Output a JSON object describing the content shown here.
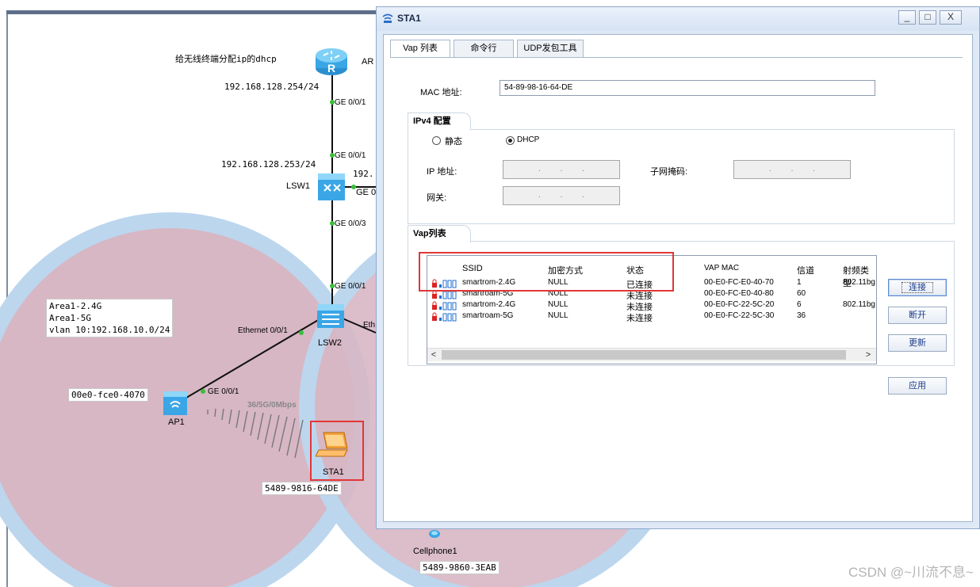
{
  "topology": {
    "router_note": "给无线终端分配ip的dhcp",
    "router_name": "AR",
    "router_ip": "192.168.128.254/24",
    "port_ar_ge001": "GE 0/0/1",
    "port_lsw1_ge001": "GE 0/0/1",
    "lsw1_ip": "192.168.128.253/24",
    "lsw1_ip_partial": "192.",
    "lsw1_name": "LSW1",
    "port_lsw1_right": "GE 0",
    "port_lsw1_ge003": "GE 0/0/3",
    "port_lsw2_ge001": "GE 0/0/1",
    "lsw2_name": "LSW2",
    "port_lsw2_eth001": "Ethernet 0/0/1",
    "port_lsw2_right": "Eth",
    "area_note_lines": [
      "Area1-2.4G",
      "Area1-5G",
      "vlan 10:192.168.10.0/24"
    ],
    "ap1_mac": "00e0-fce0-4070",
    "ap1_port": "GE 0/0/1",
    "ap1_name": "AP1",
    "wireless_link": "36/5G/0Mbps",
    "sta1_name": "STA1",
    "sta1_mac": "5489-9816-64DE",
    "cellphone_name": "Cellphone1",
    "cellphone_mac": "5489-9860-3EAB"
  },
  "window": {
    "title": "STA1",
    "buttons": {
      "minimize": "_",
      "maximize": "□",
      "close": "X"
    },
    "tabs": [
      {
        "label": "Vap 列表",
        "active": true
      },
      {
        "label": "命令行",
        "active": false
      },
      {
        "label": "UDP发包工具",
        "active": false
      }
    ],
    "mac_label": "MAC 地址:",
    "mac_value": "54-89-98-16-64-DE",
    "ipv4": {
      "group_title": "IPv4 配置",
      "static_label": "静态",
      "dhcp_label": "DHCP",
      "selected": "DHCP",
      "ip_label": "IP 地址:",
      "mask_label": "子网掩码:",
      "gateway_label": "网关:",
      "ip_value": ". . .",
      "mask_value": ". . .",
      "gateway_value": ". . ."
    },
    "vap": {
      "group_title": "Vap列表",
      "columns": [
        "SSID",
        "加密方式",
        "状态",
        "VAP MAC",
        "信道",
        "射频类型"
      ],
      "rows": [
        {
          "ssid": "smartrom-2.4G",
          "enc": "NULL",
          "status": "已连接",
          "mac": "00-E0-FC-E0-40-70",
          "channel": "1",
          "radio": "802.11bg"
        },
        {
          "ssid": "smartroam-5G",
          "enc": "NULL",
          "status": "未连接",
          "mac": "00-E0-FC-E0-40-80",
          "channel": "60",
          "radio": ""
        },
        {
          "ssid": "smartrom-2.4G",
          "enc": "NULL",
          "status": "未连接",
          "mac": "00-E0-FC-22-5C-20",
          "channel": "6",
          "radio": "802.11bg"
        },
        {
          "ssid": "smartroam-5G",
          "enc": "NULL",
          "status": "未连接",
          "mac": "00-E0-FC-22-5C-30",
          "channel": "36",
          "radio": ""
        }
      ],
      "scroll_left": "<",
      "scroll_right": ">"
    },
    "actions": {
      "connect": "连接",
      "disconnect": "断开",
      "refresh": "更新",
      "apply": "应用"
    }
  },
  "watermark": "CSDN @~川流不息~",
  "colors": {
    "accent_red": "#e23636",
    "coverage_fill": "#d9b9c6",
    "coverage_ring": "#bcd6ee"
  }
}
